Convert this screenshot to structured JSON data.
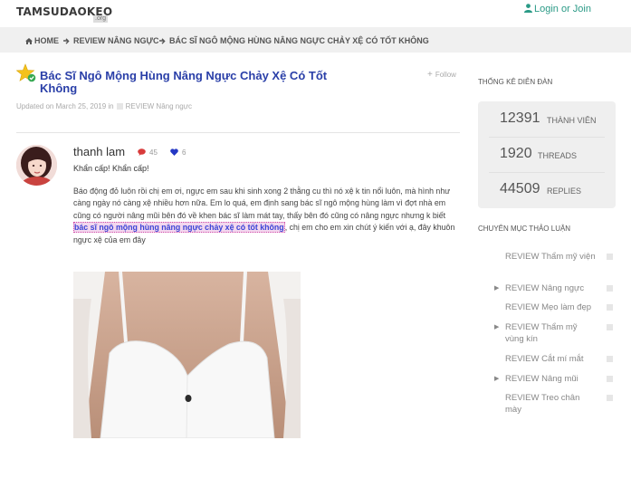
{
  "header": {
    "logo": "TAMSUDAOKEO",
    "logo_sub": ".org",
    "login_label": "Login or Join"
  },
  "breadcrumb": {
    "home": "HOME",
    "category": "REVIEW NÂNG NGỰC",
    "post": "BÁC SĨ NGÔ MỘNG HÙNG NÂNG NGỰC CHẢY XỆ CÓ TỐT KHÔNG"
  },
  "post": {
    "title": "Bác Sĩ Ngô Mộng Hùng Nâng Ngực Chảy Xệ Có Tốt Không",
    "follow_label": "Follow",
    "updated": "Updated on March 25, 2019 in",
    "category": "REVIEW Nâng ngực",
    "author": "thanh lam",
    "post_count": "45",
    "like_count": "6",
    "shout": "Khẩn cấp! Khẩn cấp!",
    "body_before": "Báo động đỏ luôn rồi chị em ơi, ngực em sau khi sinh xong 2 thằng cu thì nó xệ k tin nổi luôn, mà hình như càng ngày nó càng xệ nhiều hơn nữa. Em lo quá, em định sang bác sĩ ngô mộng hùng làm vì đợt nhà em cũng có người nâng mũi bên đó về khen bác sĩ làm mát tay, thấy bên đó cũng có nâng ngực nhưng k biết ",
    "body_link": "bác sĩ ngô mộng hùng nâng ngực chảy xệ có tốt không",
    "body_after": ", chị em cho em xin chút ý kiến với ạ, đây khuôn ngực xệ của em đây"
  },
  "sidebar": {
    "stats_title": "THỐNG KÊ DIỄN ĐÀN",
    "stats": [
      {
        "value": "12391",
        "label": "THÀNH VIÊN"
      },
      {
        "value": "1920",
        "label": "THREADS"
      },
      {
        "value": "44509",
        "label": "REPLIES"
      }
    ],
    "categories_title": "CHUYÊN MỤC THẢO LUẬN",
    "categories": [
      {
        "label": "REVIEW Thẩm mỹ viện",
        "has_arrow": false
      },
      {
        "label": "REVIEW Nâng ngực",
        "has_arrow": true
      },
      {
        "label": "REVIEW Mẹo làm đẹp",
        "has_arrow": false
      },
      {
        "label": "REVIEW Thẩm mỹ vùng kín",
        "has_arrow": true
      },
      {
        "label": "REVIEW Cắt mí mắt",
        "has_arrow": false
      },
      {
        "label": "REVIEW Nâng mũi",
        "has_arrow": true
      },
      {
        "label": "REVIEW Treo chân mày",
        "has_arrow": false
      }
    ]
  },
  "colors": {
    "accent": "#2a9a86",
    "title_blue": "#2a3fa8",
    "link_blue": "#3b44d6",
    "highlight": "#f3d7ee"
  }
}
